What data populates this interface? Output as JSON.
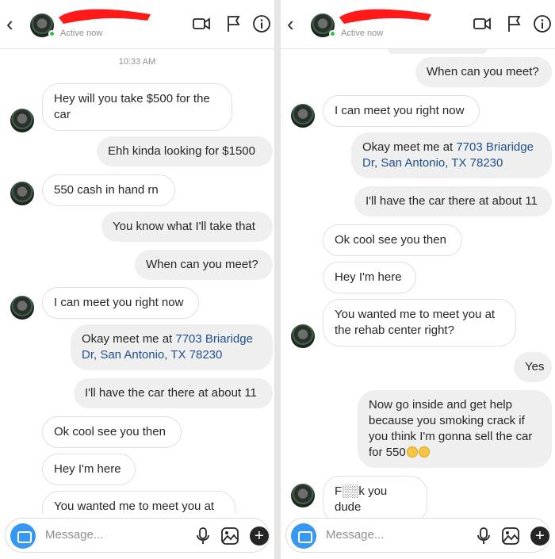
{
  "header": {
    "status": "Active now",
    "back_icon": "chevron-left-icon"
  },
  "composer": {
    "placeholder": "Message..."
  },
  "left": {
    "timestamp": "10:33 AM",
    "messages": [
      {
        "dir": "in",
        "text": "Hey will you take $500 for the car"
      },
      {
        "dir": "out",
        "text": "Ehh kinda looking for $1500"
      },
      {
        "dir": "in",
        "text": "550 cash in hand rn"
      },
      {
        "dir": "out",
        "text": "You know what I'll take that"
      },
      {
        "dir": "out",
        "text": "When can you meet?"
      },
      {
        "dir": "in",
        "text": "I can meet you right now"
      },
      {
        "dir": "out",
        "prefix": "Okay meet me at ",
        "link": "7703 Briaridge Dr, San Antonio, TX 78230"
      },
      {
        "dir": "out",
        "text": "I'll have the car there at about 11"
      },
      {
        "dir": "in",
        "text": "Ok cool see you then"
      },
      {
        "dir": "in",
        "text": "Hey I'm here"
      },
      {
        "dir": "in",
        "text": "You wanted me to meet you at"
      }
    ]
  },
  "right": {
    "messages": [
      {
        "dir": "out",
        "text": "When can you meet?"
      },
      {
        "dir": "in",
        "text": "I can meet you right now"
      },
      {
        "dir": "out",
        "prefix": "Okay meet me at ",
        "link": "7703 Briaridge Dr, San Antonio, TX 78230"
      },
      {
        "dir": "out",
        "text": "I'll have the car there at about 11"
      },
      {
        "dir": "in",
        "text": "Ok cool see you then"
      },
      {
        "dir": "in",
        "text": "Hey I'm here"
      },
      {
        "dir": "in",
        "text": "You wanted me to meet you at the rehab center right?"
      },
      {
        "dir": "out",
        "text": "Yes"
      },
      {
        "dir": "out",
        "text": "Now go inside and get help because you smoking crack if you think I'm gonna sell the car for 550",
        "emoji_count": 2
      },
      {
        "dir": "in",
        "text": "F░░k you dude"
      }
    ]
  }
}
